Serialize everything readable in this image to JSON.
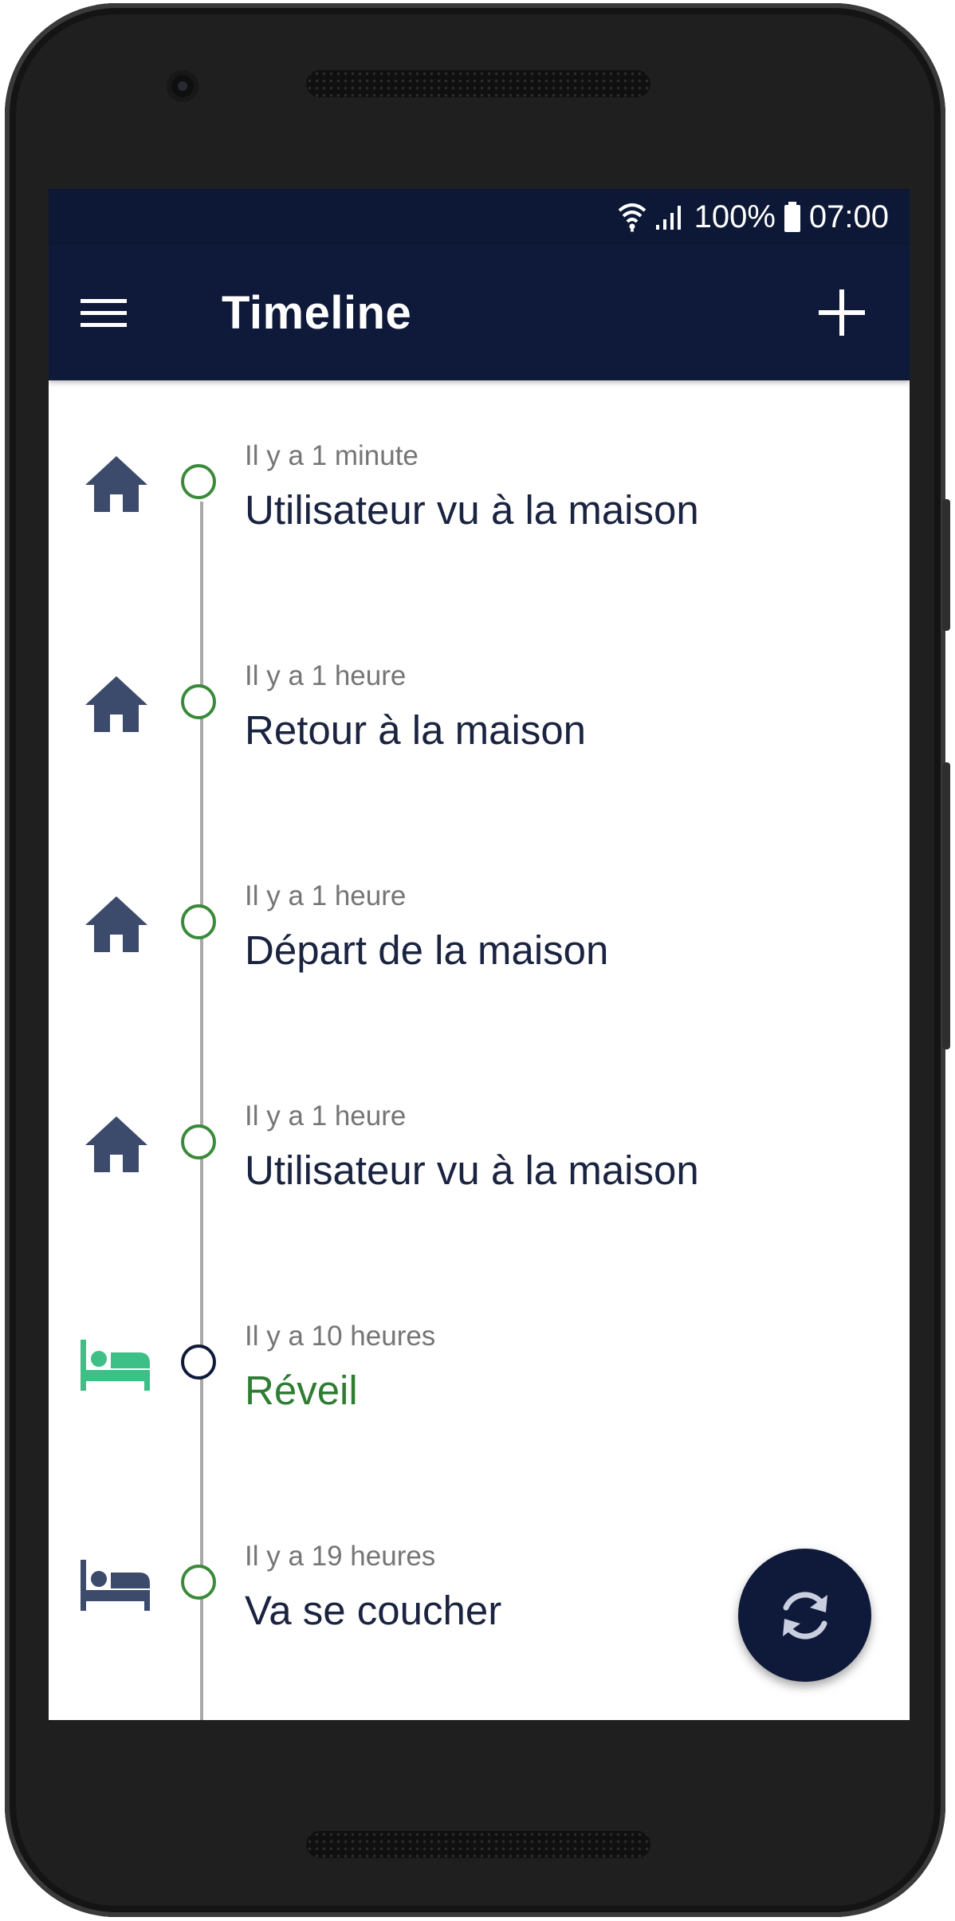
{
  "status_bar": {
    "battery": "100%",
    "time": "07:00",
    "icons": [
      "wifi-icon",
      "signal-icon",
      "battery-icon"
    ]
  },
  "app_bar": {
    "title": "Timeline",
    "menu_icon": "menu-icon",
    "add_icon": "plus-icon"
  },
  "timeline": {
    "items": [
      {
        "time": "Il y a 1 minute",
        "label": "Utilisateur vu à la maison",
        "icon": "home-icon"
      },
      {
        "time": "Il y a 1 heure",
        "label": "Retour à la maison",
        "icon": "home-icon"
      },
      {
        "time": "Il y a 1 heure",
        "label": "Départ de la maison",
        "icon": "home-icon"
      },
      {
        "time": "Il y a 1 heure",
        "label": "Utilisateur vu à la maison",
        "icon": "home-icon"
      },
      {
        "time": "Il y a 10 heures",
        "label": "Réveil",
        "icon": "bed-icon"
      },
      {
        "time": "Il y a 19 heures",
        "label": "Va se coucher",
        "icon": "bed-icon"
      }
    ]
  },
  "fab": {
    "icon": "sync-icon"
  },
  "colors": {
    "app_bar": "#0f1a3a",
    "status_bar": "#0d1836",
    "accent_green": "#2e7d32",
    "wake_icon_green": "#3dbf86",
    "icon_slate": "#3c4a6b"
  }
}
